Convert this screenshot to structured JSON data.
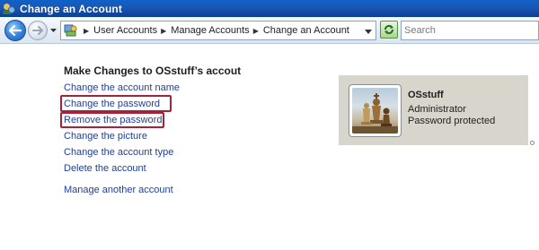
{
  "window": {
    "title": "Change an Account"
  },
  "nav": {
    "breadcrumbs": [
      "User Accounts",
      "Manage Accounts",
      "Change an Account"
    ],
    "search_placeholder": "Search"
  },
  "main": {
    "heading": "Make Changes to OSstuff’s accout",
    "tasks": [
      "Change the account name",
      "Change the password",
      "Remove the password",
      "Change the picture",
      "Change the account type",
      "Delete the account"
    ],
    "other_task": "Manage another account"
  },
  "account": {
    "name": "OSstuff",
    "type": "Administrator",
    "status": "Password protected"
  },
  "colors": {
    "link": "#1f3f9a",
    "highlight": "#a4233a",
    "card_bg": "#d7d5cc",
    "titlebar": "#1a56b4"
  },
  "icons": {
    "app": "users-icon",
    "back": "back-arrow-icon",
    "forward": "forward-arrow-icon",
    "location": "control-panel-icon",
    "refresh": "refresh-icon"
  }
}
